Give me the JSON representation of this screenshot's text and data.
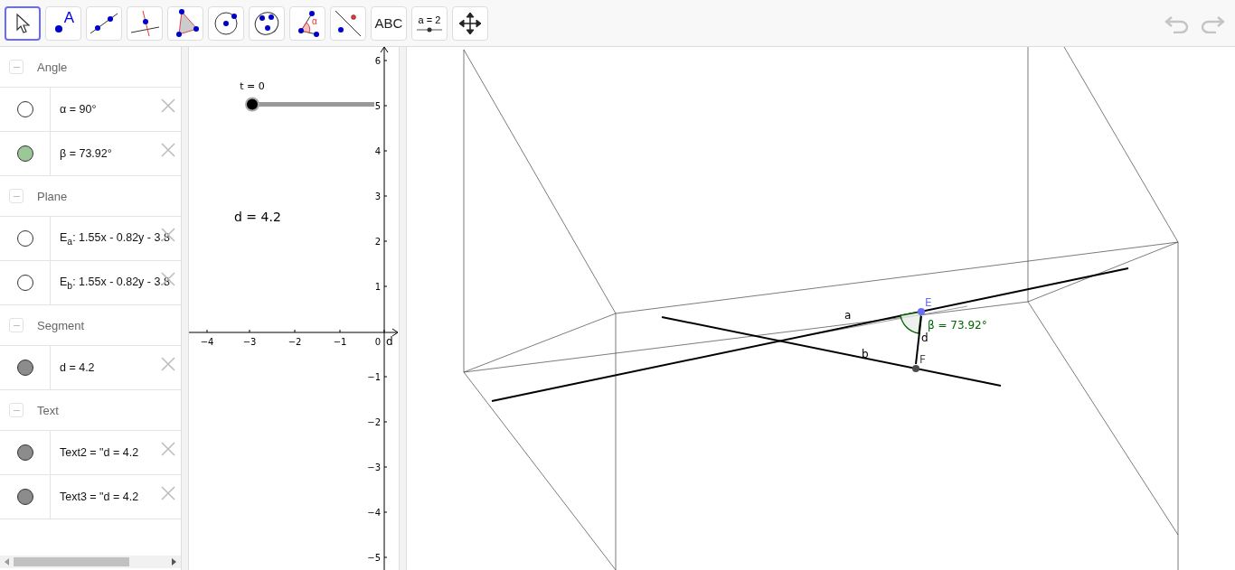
{
  "toolbar": {
    "tools": [
      {
        "kind": "move",
        "selected": true
      },
      {
        "kind": "point",
        "label": "A",
        "selected": false
      },
      {
        "kind": "line",
        "selected": false
      },
      {
        "kind": "perpendicular",
        "selected": false
      },
      {
        "kind": "polygon",
        "selected": false
      },
      {
        "kind": "circle",
        "selected": false
      },
      {
        "kind": "conic",
        "selected": false
      },
      {
        "kind": "angle",
        "label": "α",
        "selected": false
      },
      {
        "kind": "reflect",
        "selected": false
      },
      {
        "kind": "text",
        "label": "ABC",
        "selected": false
      },
      {
        "kind": "slider",
        "label": "a = 2",
        "selected": false
      },
      {
        "kind": "move-view",
        "selected": false
      }
    ]
  },
  "algebra": {
    "groups": [
      {
        "title": "Angle",
        "expanded": true,
        "items": [
          {
            "text": "α = 90°",
            "visible": false
          },
          {
            "text": "β = 73.92°",
            "visible": true,
            "color": "#9cc898"
          }
        ]
      },
      {
        "title": "Plane",
        "expanded": true,
        "items": [
          {
            "text": "E$_{a}$: 1.55x - 0.82y - 3.8",
            "visible": false
          },
          {
            "text": "E$_{b}$: 1.55x - 0.82y - 3.8",
            "visible": false
          }
        ]
      },
      {
        "title": "Segment",
        "expanded": true,
        "items": [
          {
            "text": "d = 4.2",
            "visible": true,
            "color": "#8c8c8c"
          }
        ]
      },
      {
        "title": "Text",
        "expanded": true,
        "items": [
          {
            "text": "Text2 =  \"d = 4.2",
            "visible": true,
            "color": "#8c8c8c"
          },
          {
            "text": "Text3 =  \"d = 4.2",
            "visible": true,
            "color": "#8c8c8c"
          }
        ]
      }
    ]
  },
  "graphics": {
    "x_ticks": [
      "−4",
      "−3",
      "−2",
      "−1",
      "0"
    ],
    "y_ticks": [
      "6",
      "5",
      "4",
      "3",
      "2",
      "1",
      "−1",
      "−2",
      "−3",
      "−4",
      "−5"
    ],
    "x_axis_label": "d",
    "slider": {
      "label": "t = 0",
      "level": 0
    },
    "text": "d = 4.2"
  },
  "view_3d": {
    "objects": [
      {
        "kind": "line",
        "label": "a"
      },
      {
        "kind": "line",
        "label": "b"
      },
      {
        "kind": "angle",
        "label": "β = 73.92°"
      },
      {
        "kind": "segment",
        "label": "d"
      },
      {
        "kind": "point",
        "label": "E",
        "color": "#6b6bff"
      },
      {
        "kind": "point",
        "label": "F",
        "color": "#4d4d4d"
      }
    ]
  }
}
